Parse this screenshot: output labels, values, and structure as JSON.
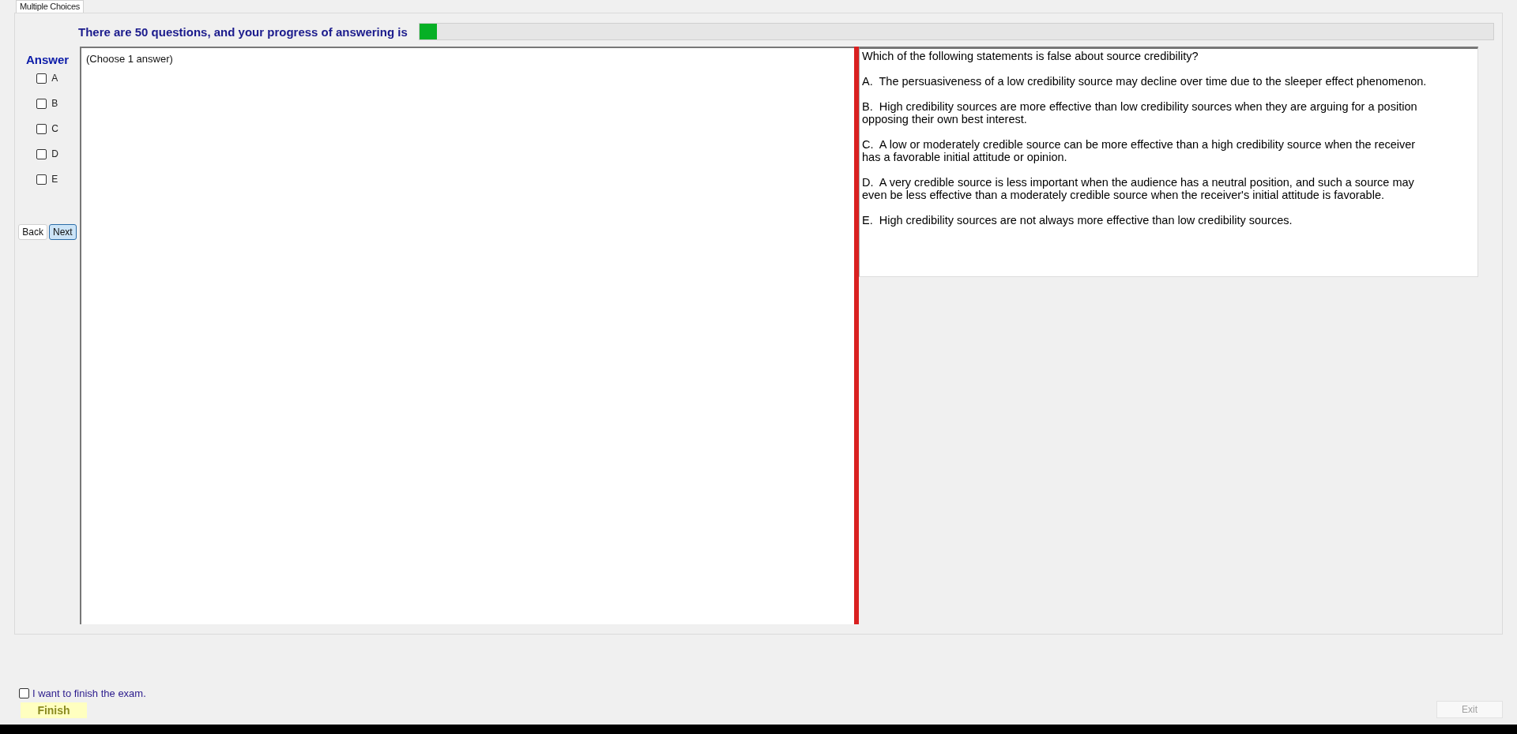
{
  "tabs": [
    {
      "label": "Multiple Choices",
      "selected": true
    }
  ],
  "progress": {
    "text": "There are 50 questions, and your progress of answering is",
    "level": 0.016
  },
  "answer_panel": {
    "title": "Answer",
    "options": [
      {
        "label": "A",
        "checked": false
      },
      {
        "label": "B",
        "checked": false
      },
      {
        "label": "C",
        "checked": false
      },
      {
        "label": "D",
        "checked": false
      },
      {
        "label": "E",
        "checked": false
      }
    ],
    "buttons": [
      {
        "label": "Back",
        "focused": false
      },
      {
        "label": "Next",
        "focused": true
      }
    ]
  },
  "answer_area": {
    "hint": "(Choose 1 answer)"
  },
  "question": {
    "text": "Which of the following statements is false about source credibility?",
    "choices": [
      "A.  The persuasiveness of a low credibility source may decline over time due to the sleeper effect phenomenon.",
      "B.  High credibility sources are more effective than low credibility sources when they are arguing for a position opposing their own best interest.",
      "C.  A low or moderately credible source can be more effective than a high credibility source when the receiver has a favorable initial attitude or opinion.",
      "D.  A very credible source is less important when the audience has a neutral position, and such a source may even be less effective than a moderately credible source when the receiver's initial attitude is favorable.",
      "E.  High credibility sources are not always more effective than low credibility sources."
    ]
  },
  "finish": {
    "confirm_label": "I want to finish the exam.",
    "confirm_checked": false,
    "finish_button": "Finish",
    "exit_button": {
      "label": "Exit",
      "disabled": true
    }
  }
}
